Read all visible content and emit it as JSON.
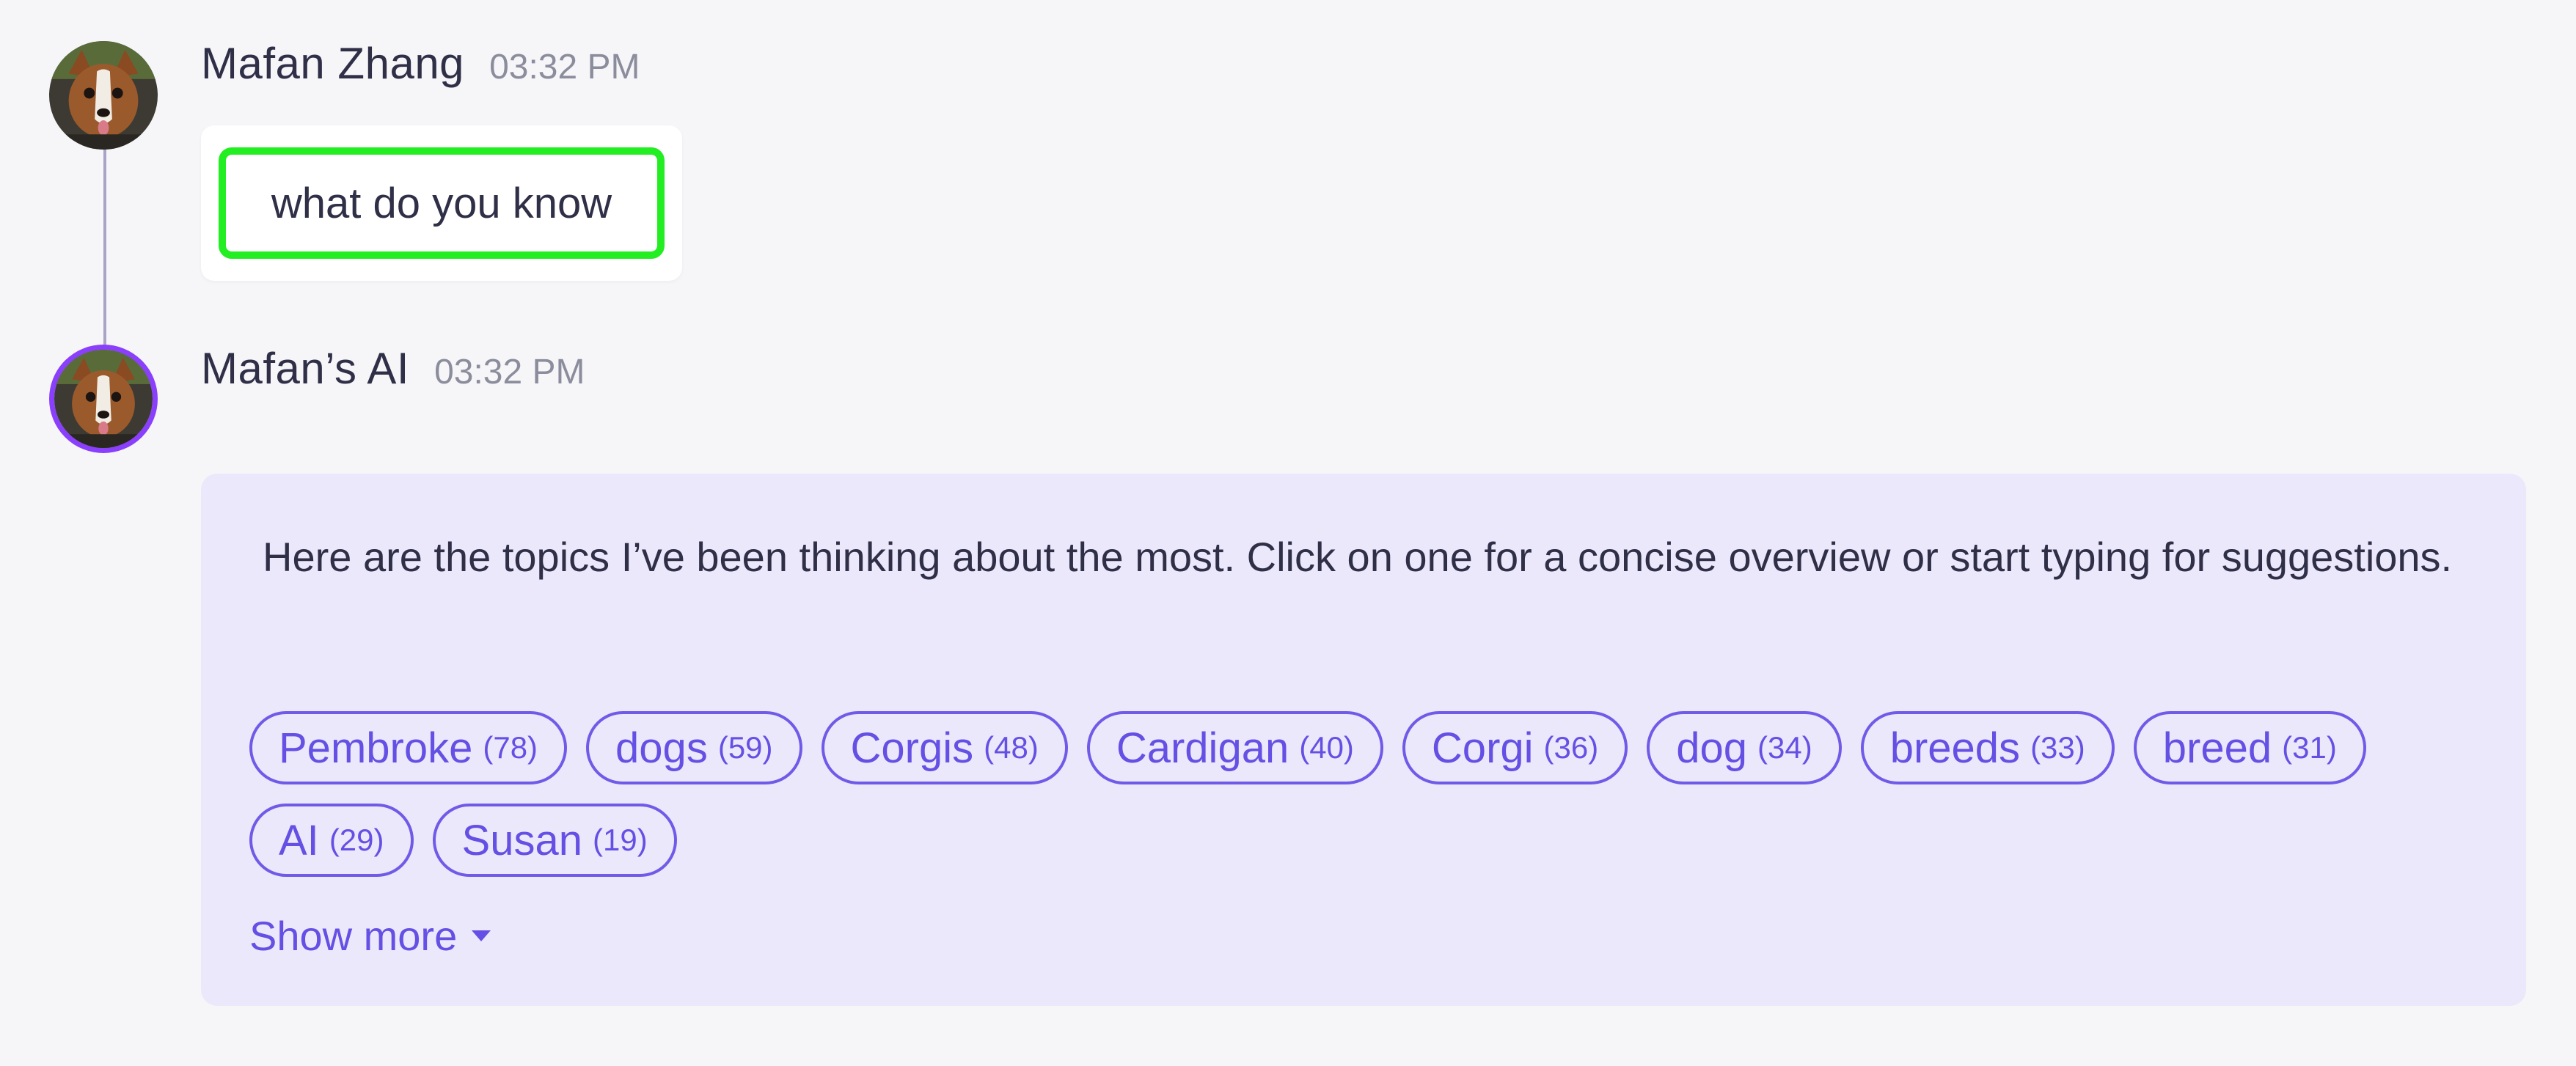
{
  "user_message": {
    "author": "Mafan Zhang",
    "time": "03:32 PM",
    "text": "what do you know",
    "avatar_icon": "corgi-avatar-icon"
  },
  "ai_message": {
    "author": "Mafan’s AI",
    "time": "03:32 PM",
    "text": "Here are the topics I’ve been thinking about the most. Click on one for a concise overview or start typing for suggestions.",
    "avatar_icon": "corgi-avatar-icon",
    "topics": [
      {
        "label": "Pembroke",
        "count": "(78)"
      },
      {
        "label": "dogs",
        "count": "(59)"
      },
      {
        "label": "Corgis",
        "count": "(48)"
      },
      {
        "label": "Cardigan",
        "count": "(40)"
      },
      {
        "label": "Corgi",
        "count": "(36)"
      },
      {
        "label": "dog",
        "count": "(34)"
      },
      {
        "label": "breeds",
        "count": "(33)"
      },
      {
        "label": "breed",
        "count": "(31)"
      },
      {
        "label": "AI",
        "count": "(29)"
      },
      {
        "label": "Susan",
        "count": "(19)"
      }
    ],
    "show_more_label": "Show more"
  },
  "colors": {
    "accent": "#6450e4",
    "ai_ring": "#8a3ffc",
    "highlight": "#22ee22",
    "ai_card_bg": "#ece8fb"
  }
}
